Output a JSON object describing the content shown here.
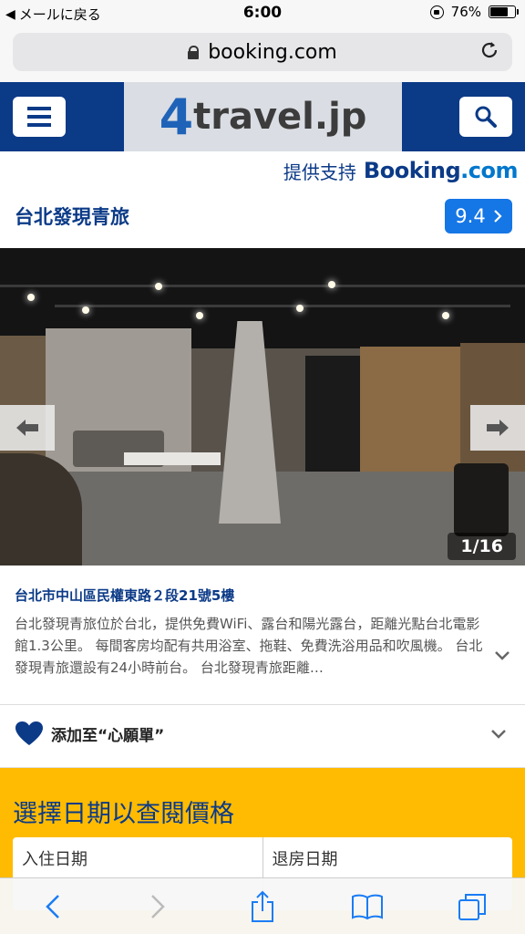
{
  "status_bar": {
    "back_label": "メールに戻る",
    "time": "6:00",
    "battery": "76%",
    "battery_level": 0.76
  },
  "browser": {
    "url": "booking.com"
  },
  "site_header": {
    "logo_number": "4",
    "logo_text": "travel.jp"
  },
  "powered_by": {
    "label": "提供支持",
    "brand": "Booking",
    "brand_suffix": ".com"
  },
  "hotel": {
    "name": "台北發現青旅",
    "score": "9.4",
    "photo_counter": "1/16",
    "address": "台北市中山區民權東路２段21號5樓",
    "description": "台北發現青旅位於台北，提供免費WiFi、露台和陽光露台，距離光點台北電影館1.3公里。 每間客房均配有共用浴室、拖鞋、免費洗浴用品和吹風機。 台北發現青旅還設有24小時前台。 台北發現青旅距離…"
  },
  "wishlist": {
    "label": "添加至“心願單”"
  },
  "date_panel": {
    "heading": "選擇日期以查閱價格",
    "checkin_label": "入住日期",
    "checkout_label": "退房日期"
  },
  "colors": {
    "brand_blue": "#0b3a87",
    "score_blue": "#1576e6",
    "date_panel_yellow": "#febb02"
  },
  "icons": {
    "menu": "hamburger-icon",
    "search": "search-icon",
    "prev": "arrow-left-icon",
    "next": "arrow-right-icon",
    "wishlist": "heart-icon",
    "expand": "chevron-down-icon"
  }
}
